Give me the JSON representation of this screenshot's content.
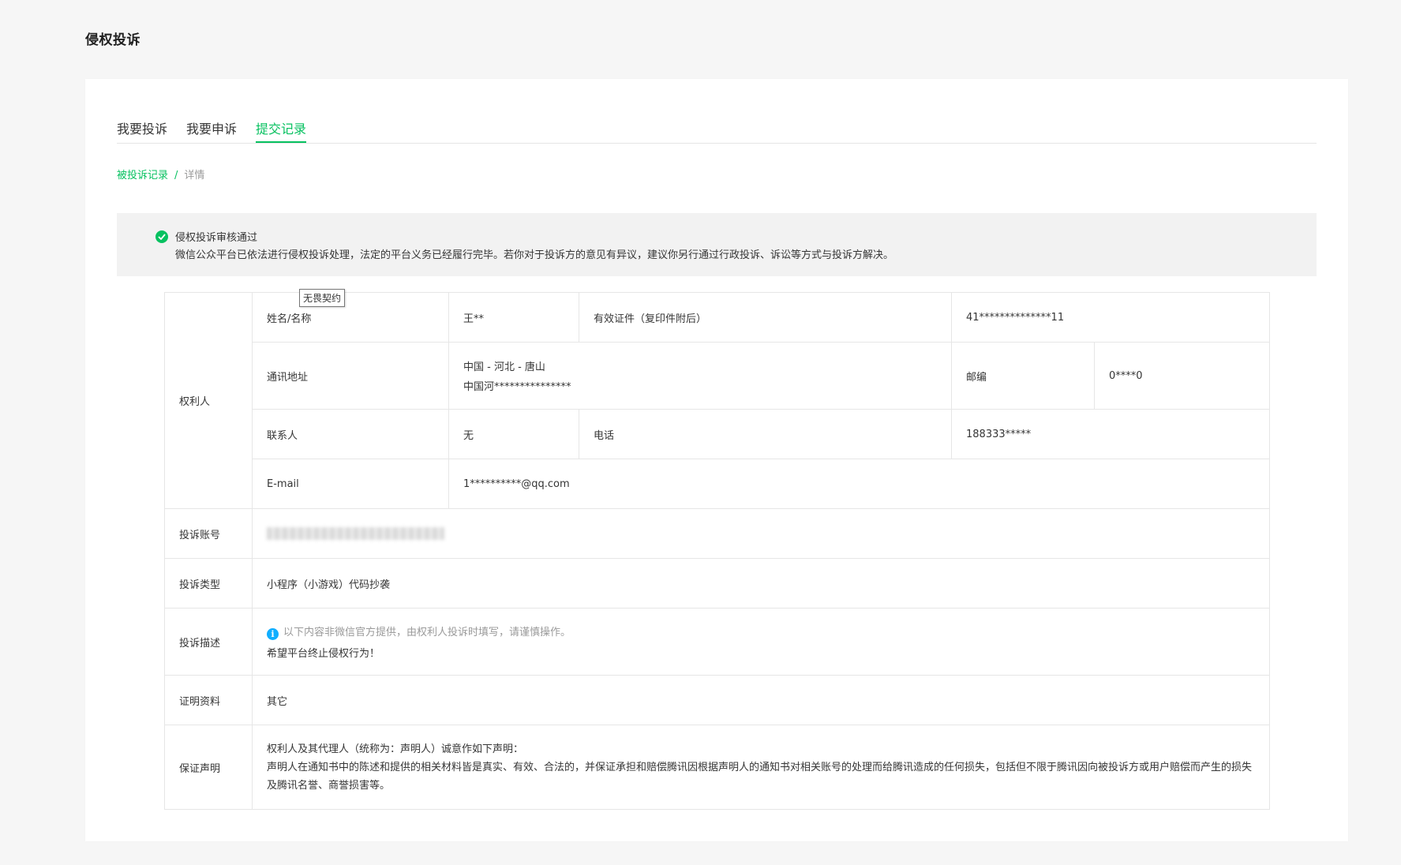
{
  "page_title": "侵权投诉",
  "tabs": [
    {
      "label": "我要投诉"
    },
    {
      "label": "我要申诉"
    },
    {
      "label": "提交记录"
    }
  ],
  "breadcrumb": {
    "link": "被投诉记录",
    "separator": "/",
    "current": "详情"
  },
  "notice": {
    "title": "侵权投诉审核通过",
    "desc": "微信公众平台已依法进行侵权投诉处理，法定的平台义务已经履行完毕。若你对于投诉方的意见有异议，建议你另行通过行政投诉、诉讼等方式与投诉方解决。"
  },
  "tooltip": "无畏契约",
  "rights_holder": {
    "label": "权利人",
    "name_label": "姓名/名称",
    "name_value": "王**",
    "id_label": "有效证件（复印件附后）",
    "id_value": "41**************11",
    "address_label": "通讯地址",
    "address_line1": "中国 - 河北 - 唐山",
    "address_line2": "中国河***************",
    "postcode_label": "邮编",
    "postcode_value": "0****0",
    "contact_label": "联系人",
    "contact_value": "无",
    "phone_label": "电话",
    "phone_value": "188333*****",
    "email_label": "E-mail",
    "email_value": "1**********@qq.com"
  },
  "account": {
    "label": "投诉账号"
  },
  "type": {
    "label": "投诉类型",
    "value": "小程序（小游戏）代码抄袭"
  },
  "description": {
    "label": "投诉描述",
    "hint": "以下内容非微信官方提供，由权利人投诉时填写，请谨慎操作。",
    "value": "希望平台终止侵权行为！"
  },
  "evidence": {
    "label": "证明资料",
    "value": "其它"
  },
  "declaration": {
    "label": "保证声明",
    "line1": "权利人及其代理人（统称为：声明人）诚意作如下声明：",
    "line2": "声明人在通知书中的陈述和提供的相关材料皆是真实、有效、合法的，并保证承担和赔偿腾讯因根据声明人的通知书对相关账号的处理而给腾讯造成的任何损失，包括但不限于腾讯因向被投诉方或用户赔偿而产生的损失及腾讯名誉、商誉损害等。"
  },
  "colors": {
    "accent": "#07c160",
    "info": "#10aeff"
  }
}
